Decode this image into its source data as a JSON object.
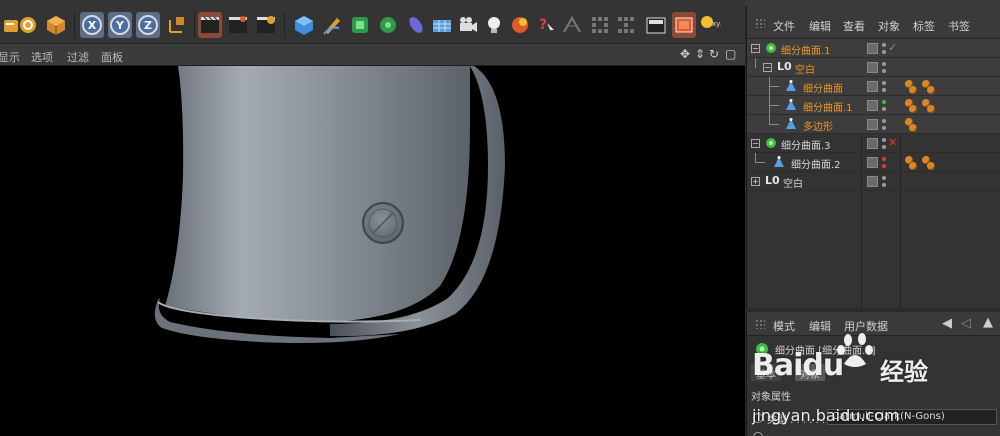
{
  "toolbar": {
    "axis_x": "X",
    "axis_y": "Y",
    "axis_z": "Z"
  },
  "viewport": {
    "menu": [
      "显示",
      "选项",
      "过滤",
      "面板"
    ]
  },
  "object_manager": {
    "menu": [
      "文件",
      "编辑",
      "查看",
      "对象",
      "标签",
      "书签"
    ],
    "objects": [
      {
        "name": "细分曲面.1",
        "color": "orange",
        "status": "✓",
        "status_color": "#3fbf3f"
      },
      {
        "name": "空白",
        "color": "orange"
      },
      {
        "name": "细分曲面",
        "color": "orange"
      },
      {
        "name": "细分曲面.1",
        "color": "orange"
      },
      {
        "name": "多边形",
        "color": "orange"
      },
      {
        "name": "细分曲面.3",
        "color": "light",
        "status": "✕",
        "status_color": "#e03a3a"
      },
      {
        "name": "细分曲面.2",
        "color": "light"
      },
      {
        "name": "空白",
        "color": "light"
      }
    ]
  },
  "attribute_manager": {
    "menu": [
      "模式",
      "编辑",
      "用户数据"
    ],
    "title": "细分曲面 [细分曲面.1]",
    "tab_basic": "基本",
    "tab_object": "对象",
    "section": "对象属性",
    "type_label": "类型 . . . . . .",
    "type_value": "Catmull-Clark(N-Gons)"
  },
  "watermark": {
    "brand": "Baidu",
    "chinese": "经验",
    "url": "jingyan.baidu.com"
  },
  "colors": {
    "accent_orange": "#e8962a",
    "check_green": "#3fbf3f",
    "cross_red": "#e03a3a",
    "viewport_bg": "#000000"
  }
}
